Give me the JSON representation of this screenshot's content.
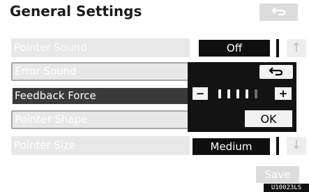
{
  "window": {
    "title": "General Settings"
  },
  "settings": [
    {
      "label": "Pointer Sound",
      "value": "Off"
    },
    {
      "label": "Error Sound"
    },
    {
      "label": "Feedback Force"
    },
    {
      "label": "Pointer Shape"
    },
    {
      "label": "Pointer Size",
      "value": "Medium"
    }
  ],
  "popup": {
    "minus_label": "−",
    "plus_label": "+",
    "ok_label": "OK",
    "feedback_level": 4,
    "feedback_max": 5
  },
  "footer": {
    "save_label": "Save",
    "code": "U10023LS"
  },
  "icons": {
    "back": "back-arrow-icon",
    "scroll_up": "up-arrow-icon",
    "scroll_down": "down-arrow-icon"
  },
  "colors": {
    "selected_row": "#3a3a3a",
    "popup_bg": "#131313",
    "value_box": "#0f0f0f"
  }
}
